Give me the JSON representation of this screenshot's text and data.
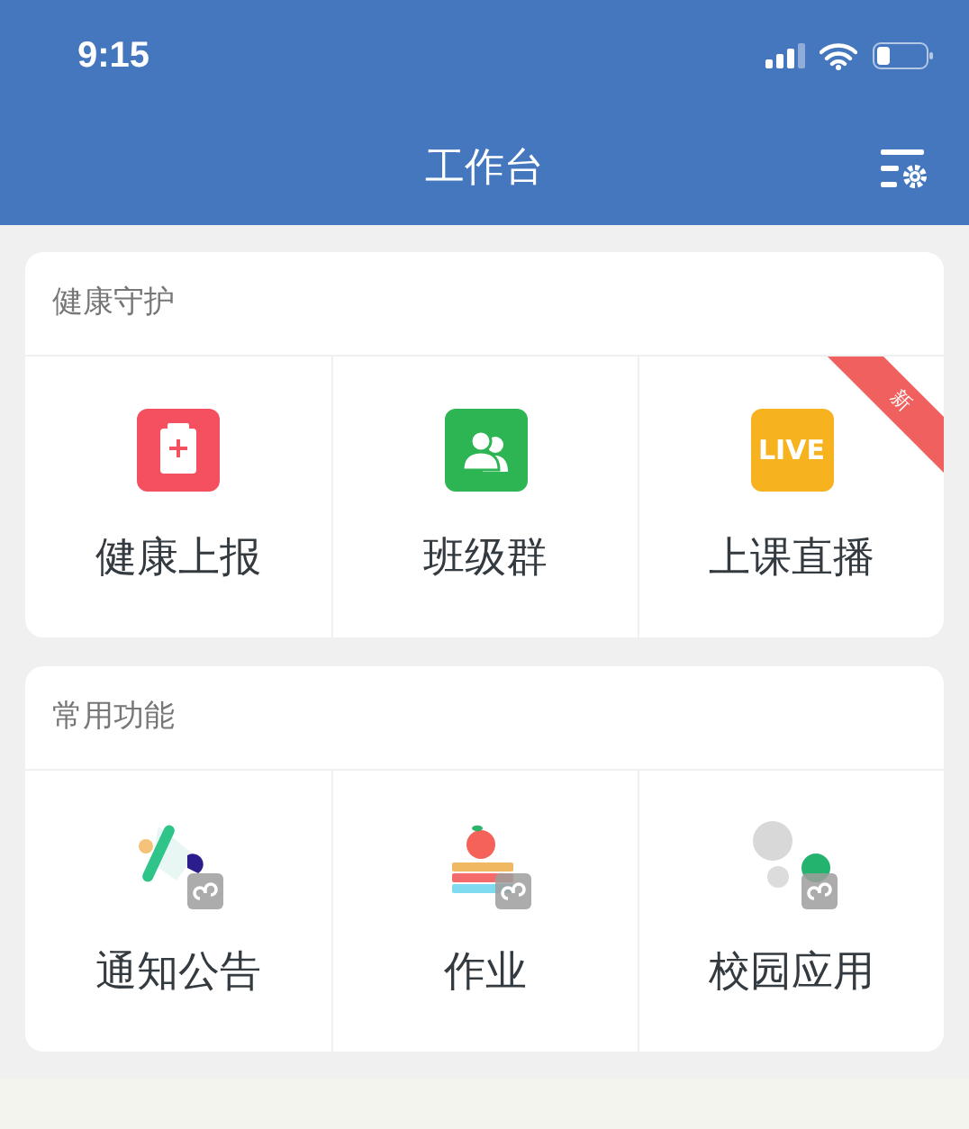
{
  "status_bar": {
    "time": "9:15"
  },
  "nav": {
    "title": "工作台"
  },
  "sections": [
    {
      "title": "健康守护",
      "items": [
        {
          "label": "健康上报",
          "kind": "clipboard"
        },
        {
          "label": "班级群",
          "kind": "people"
        },
        {
          "label": "上课直播",
          "kind": "live",
          "icon_text": "LIVE",
          "ribbon": "新"
        }
      ]
    },
    {
      "title": "常用功能",
      "items": [
        {
          "label": "通知公告",
          "kind": "megaphone"
        },
        {
          "label": "作业",
          "kind": "books"
        },
        {
          "label": "校园应用",
          "kind": "bubbles"
        }
      ]
    }
  ]
}
